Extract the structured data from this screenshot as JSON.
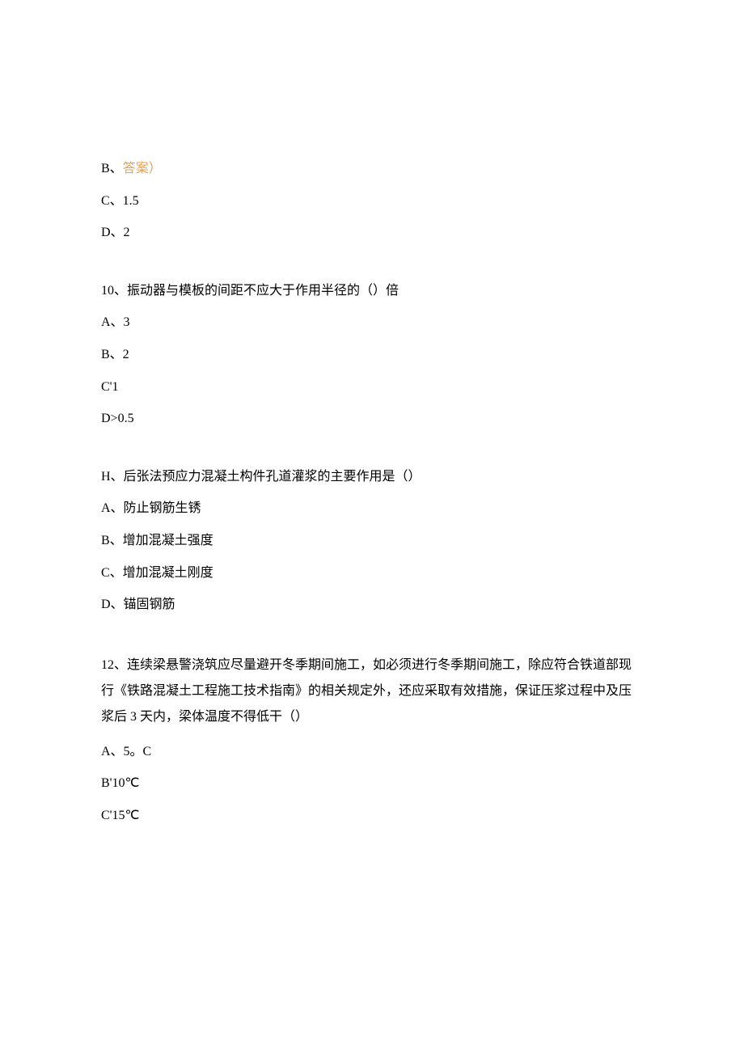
{
  "q9_remainder": {
    "optB_prefix": "B、",
    "optB_answer": "答案）",
    "optC": "C、1.5",
    "optD": "D、2"
  },
  "q10": {
    "question": "10、振动器与模板的间距不应大于作用半径的（）倍",
    "optA": "A、3",
    "optB": "B、2",
    "optC": "C'1",
    "optD": "D>0.5"
  },
  "q11": {
    "question": "H、后张法预应力混凝土构件孔道灌浆的主要作用是（）",
    "optA": "A、防止钢筋生锈",
    "optB": "B、增加混凝土强度",
    "optC": "C、增加混凝土刚度",
    "optD": "D、锚固钢筋"
  },
  "q12": {
    "question": "12、连续梁悬警浇筑应尽量避开冬季期间施工，如必须进行冬季期间施工，除应符合铁道部现行《铁路混凝土工程施工技术指南》的相关规定外，还应采取有效措施，保证压浆过程中及压浆后 3 天内，梁体温度不得低干（）",
    "optA": "A、5。C",
    "optB": "B'10℃",
    "optC": "C'15℃"
  }
}
